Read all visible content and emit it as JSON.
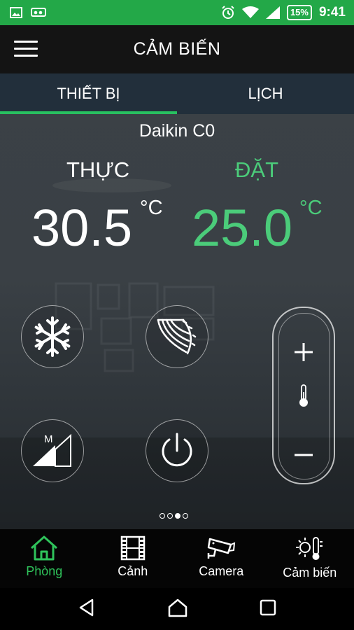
{
  "status_bar": {
    "battery": "15%",
    "time": "9:41",
    "icons": [
      "image-icon",
      "voicemail-icon",
      "alarm-icon",
      "wifi-icon",
      "signal-icon",
      "battery-icon"
    ]
  },
  "app_bar": {
    "title": "CẢM BIẾN",
    "menu_icon": "hamburger-menu-icon"
  },
  "tabs": [
    {
      "label": "THIẾT BỊ",
      "active": true
    },
    {
      "label": "LỊCH",
      "active": false
    }
  ],
  "device": {
    "name": "Daikin C0",
    "actual_label": "THỰC",
    "set_label": "ĐẶT",
    "actual_temp": "30.5",
    "set_temp": "25.0",
    "unit": "°C"
  },
  "controls": {
    "mode_icon": "snowflake-icon",
    "swing_icon": "swing-icon",
    "fan_label": "M",
    "power_icon": "power-icon",
    "plus": "+",
    "minus": "−"
  },
  "pager": {
    "count": 4,
    "active_index": 2
  },
  "bottom_nav": [
    {
      "label": "Phòng",
      "icon": "home-icon",
      "active": true
    },
    {
      "label": "Cảnh",
      "icon": "film-icon",
      "active": false
    },
    {
      "label": "Camera",
      "icon": "camera-icon",
      "active": false
    },
    {
      "label": "Cảm biến",
      "icon": "sensor-icon",
      "active": false
    }
  ],
  "colors": {
    "status_green": "#23a848",
    "accent_green": "#4bcc7a",
    "tab_indicator": "#28c060"
  }
}
